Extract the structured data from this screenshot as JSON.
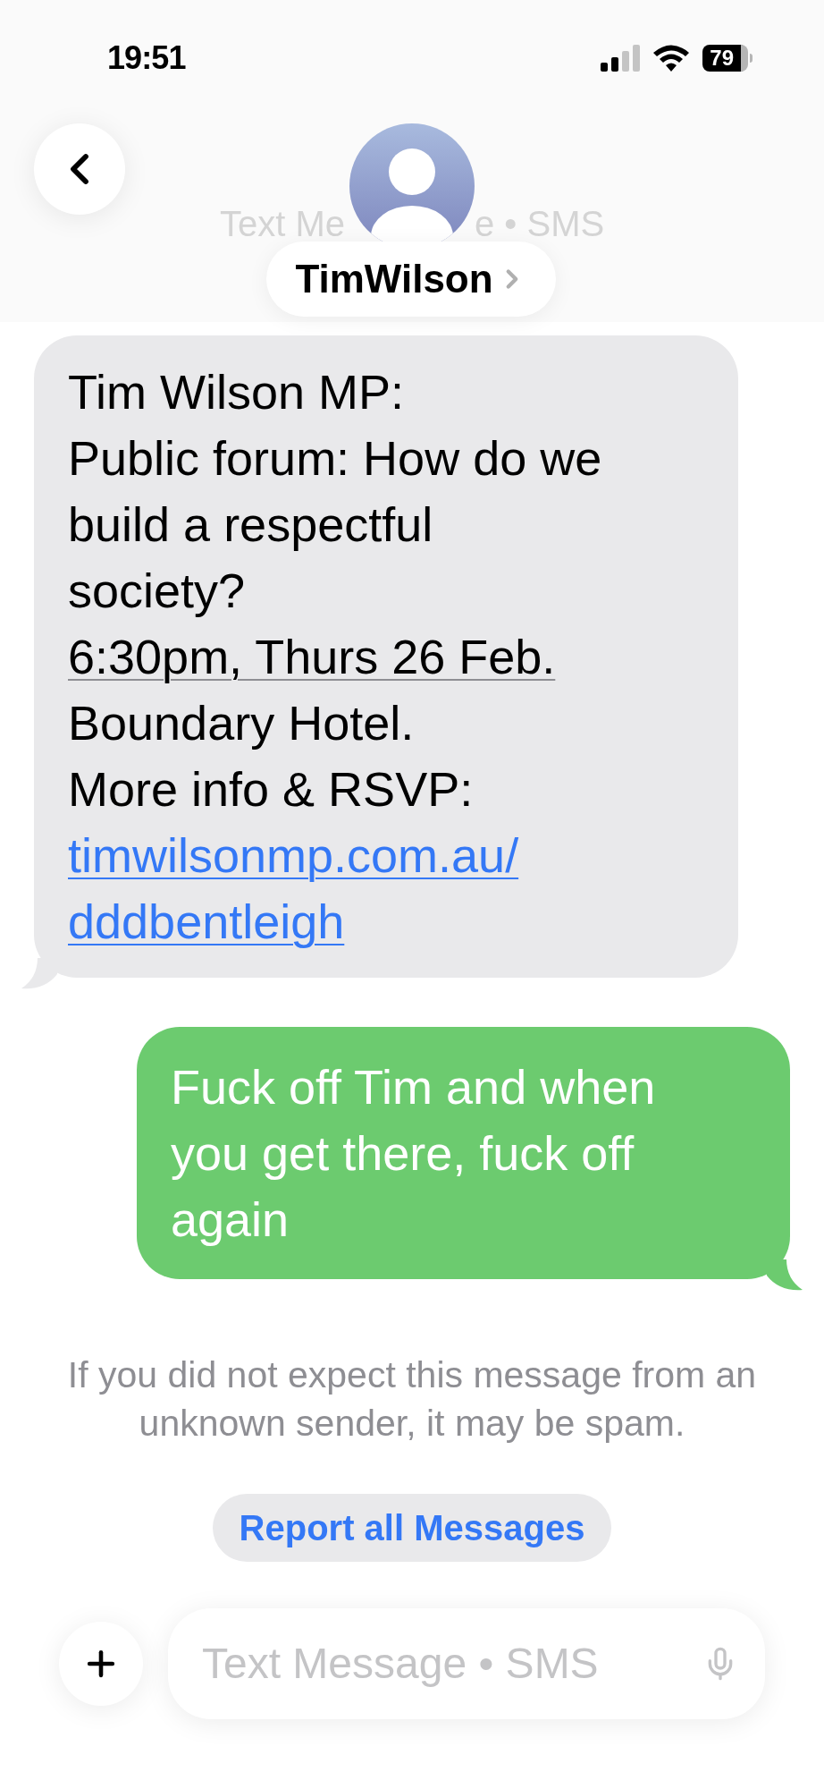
{
  "status_bar": {
    "time": "19:51",
    "battery": "79"
  },
  "header": {
    "subtitle_parts": [
      "Text Me",
      "e • SMS"
    ],
    "contact_name": "TimWilson"
  },
  "messages": [
    {
      "kind": "incoming",
      "lines": [
        [
          {
            "kind": "text",
            "text": "Tim Wilson MP:"
          }
        ],
        [
          {
            "kind": "text",
            "text": "Public forum: How do we"
          }
        ],
        [
          {
            "kind": "text",
            "text": "build a respectful"
          }
        ],
        [
          {
            "kind": "text",
            "text": "society?"
          }
        ],
        [
          {
            "kind": "date",
            "text": "6:30pm, Thurs 26 Feb."
          }
        ],
        [
          {
            "kind": "text",
            "text": "Boundary Hotel."
          }
        ],
        [
          {
            "kind": "text",
            "text": "More info & RSVP:"
          }
        ],
        [
          {
            "kind": "link",
            "text": "timwilsonmp.com.au/"
          }
        ],
        [
          {
            "kind": "link",
            "text": "dddbentleigh"
          }
        ]
      ]
    },
    {
      "kind": "outgoing",
      "lines": [
        [
          {
            "kind": "text",
            "text": "Fuck off Tim and when"
          }
        ],
        [
          {
            "kind": "text",
            "text": "you get there, fuck off"
          }
        ],
        [
          {
            "kind": "text",
            "text": "again"
          }
        ]
      ]
    }
  ],
  "spam_notice": "If you did not expect this message from an unknown sender, it may be spam.",
  "report_button": "Report all Messages",
  "composer": {
    "placeholder": "Text Message • SMS"
  }
}
